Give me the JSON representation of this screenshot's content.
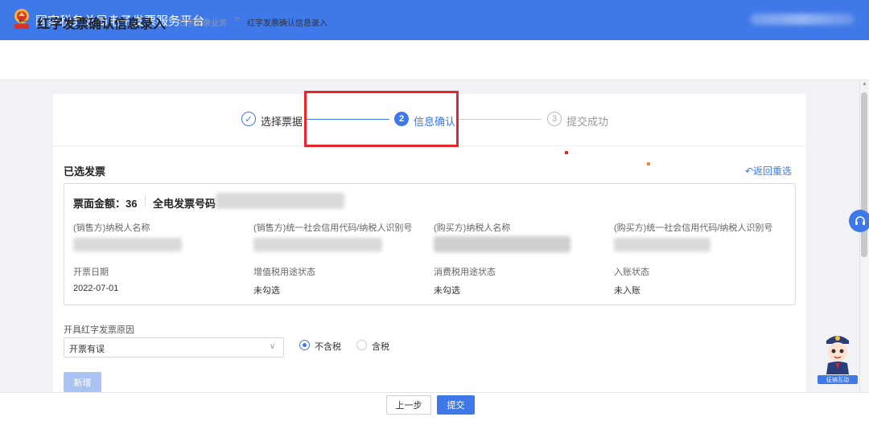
{
  "topbar": {
    "app_title": "国家税务总局电子发票服务平台"
  },
  "header": {
    "title": "红字发票确认信息录入",
    "breadcrumb": [
      "红字发票业务",
      "红字发票确认信息录入"
    ],
    "breadcrumb_separator": ">"
  },
  "steps": [
    {
      "index": "✓",
      "label": "选择票据",
      "state": "done"
    },
    {
      "index": "2",
      "label": "信息确认",
      "state": "active"
    },
    {
      "index": "3",
      "label": "提交成功",
      "state": "pending"
    }
  ],
  "section": {
    "title": "已选发票",
    "return_link": "↶返回重选"
  },
  "invoice": {
    "amount_label": "票面金额：36",
    "invoice_no_label": "全电发票号码",
    "fields": [
      {
        "label": "(销售方)纳税人名称",
        "value": ""
      },
      {
        "label": "(销售方)统一社会信用代码/纳税人识别号",
        "value": ""
      },
      {
        "label": "(购买方)纳税人名称",
        "value": ""
      },
      {
        "label": "(购买方)统一社会信用代码/纳税人识别号",
        "value": ""
      },
      {
        "label": "开票日期",
        "value": "2022-07-01"
      },
      {
        "label": "增值税用途状态",
        "value": "未勾选"
      },
      {
        "label": "消费税用途状态",
        "value": "未勾选"
      },
      {
        "label": "入账状态",
        "value": "未入账"
      }
    ]
  },
  "reason": {
    "label": "开具红字发票原因",
    "selected": "开票有误",
    "tax_options": [
      {
        "label": "不含税",
        "selected": true
      },
      {
        "label": "含税",
        "selected": false
      }
    ]
  },
  "add_button": "新增",
  "footer": {
    "prev": "上一步",
    "submit": "提交"
  },
  "assistant": {
    "label": "征纳互动"
  },
  "colors": {
    "primary": "#3f78e8",
    "highlight": "#e8242c"
  }
}
